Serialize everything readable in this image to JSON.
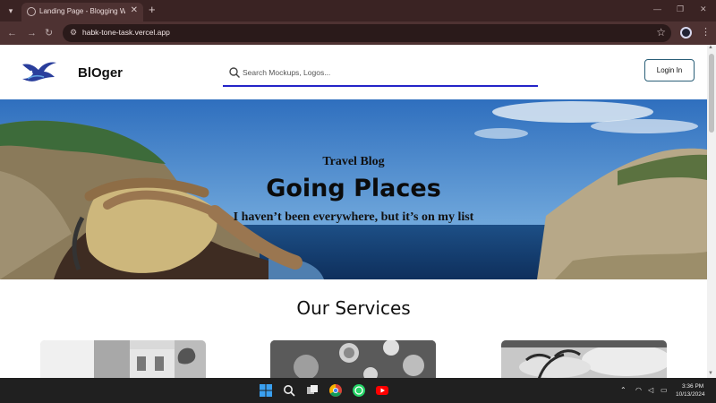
{
  "browser": {
    "tab_title": "Landing Page - Blogging Website",
    "url": "habk-tone-task.vercel.app"
  },
  "site": {
    "brand": "BlOger",
    "search_placeholder": "Search Mockups, Logos...",
    "login_label": "Login In",
    "accent": "#2424c8"
  },
  "hero": {
    "kicker": "Travel Blog",
    "title": "Going Places",
    "tagline": "I haven’t been everywhere, but it’s on my list"
  },
  "services": {
    "title": "Our Services"
  },
  "taskbar": {
    "time": "3:36 PM",
    "date": "10/13/2024"
  }
}
